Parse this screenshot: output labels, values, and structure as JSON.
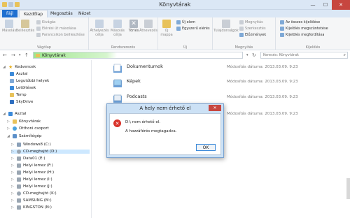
{
  "window": {
    "title": "Könyvtárak",
    "minimize": "—",
    "maximize": "☐",
    "close": "✕"
  },
  "tabs": [
    {
      "label": "Fájl"
    },
    {
      "label": "Kezdőlap"
    },
    {
      "label": "Megosztás"
    },
    {
      "label": "Nézet"
    }
  ],
  "ribbon": {
    "vagolap": {
      "label": "Vágólap",
      "copy": "Másolás",
      "paste": "Beillesztés",
      "cut": "Kivágás",
      "copy_path": "Elérési út másolása",
      "paste_shortcut": "Parancsikon beillesztése"
    },
    "rendszerezes": {
      "label": "Rendszerezés",
      "move": "Áthelyezés célja",
      "copy_to": "Másolás célja",
      "delete": "Törlés",
      "rename": "Átnevezés"
    },
    "uj": {
      "label": "Új",
      "new_folder": "Új mappa",
      "new_item": "Új elem",
      "easy_access": "Egyszerű elérés"
    },
    "megnyitas": {
      "label": "Megnyitás",
      "properties": "Tulajdonságok",
      "open": "Megnyitás",
      "edit": "Szerkesztés",
      "history": "Előzmények"
    },
    "kijeloles": {
      "label": "Kijelölés",
      "select_all": "Az összes kijelölése",
      "select_none": "Kijelölés megszüntetése",
      "invert": "Kijelölés megfordítása"
    }
  },
  "address": {
    "path": "Könyvtárak",
    "search_placeholder": "Keresés: Könyvtárak"
  },
  "nav": {
    "favorites_header": "Kedvencek",
    "favorites": [
      "Asztal",
      "Legutóbbi helyek",
      "Letöltések",
      "Temp",
      "SkyDrive"
    ],
    "desktop_header": "Asztal",
    "desktop_children": [
      "Könyvtárak",
      "Otthoni csoport"
    ],
    "computer_header": "Számítógép",
    "drives": [
      "Windows8 (C:)",
      "CD-meghajtó (D:)",
      "Data01 (E:)",
      "Helyi lemez (F:)",
      "Helyi lemez (H:)",
      "Helyi lemez (I:)",
      "Helyi lemez (J:)",
      "CD-meghajtó (K:)",
      "SAMSUNG (M:)",
      "KINGSTON (N:)"
    ]
  },
  "files": [
    {
      "name": "Dokumentumok",
      "date": "Módosítás dátuma: 2013.03.09. 9:23"
    },
    {
      "name": "Képek",
      "date": "Módosítás dátuma: 2013.03.09. 9:23"
    },
    {
      "name": "Podcasts",
      "date": "Módosítás dátuma: 2013.03.09. 9:23"
    },
    {
      "name": "",
      "date": "Módosítás dátuma: 2013.03.09. 9:23"
    }
  ],
  "dialog": {
    "title": "A hely nem érhető el",
    "close": "✕",
    "message1": "D:\\ nem érhető el.",
    "message2": "A hozzáférés megtagadva.",
    "ok": "OK"
  },
  "colors": {
    "accent": "#1e6fd0",
    "close_red": "#c7463f",
    "error_red": "#d9332b"
  }
}
